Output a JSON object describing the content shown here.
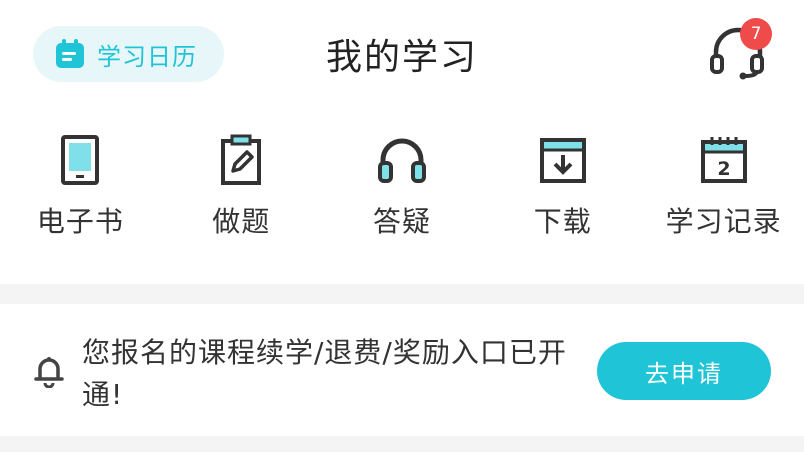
{
  "header": {
    "calendar_label": "学习日历",
    "title": "我的学习",
    "support_badge": "7"
  },
  "nav": {
    "items": [
      {
        "label": "电子书",
        "icon": "ebook-icon"
      },
      {
        "label": "做题",
        "icon": "clipboard-pen-icon"
      },
      {
        "label": "答疑",
        "icon": "headphones-icon"
      },
      {
        "label": "下载",
        "icon": "download-folder-icon"
      },
      {
        "label": "学习记录",
        "icon": "calendar-record-icon"
      }
    ]
  },
  "notice": {
    "text": "您报名的课程续学/退费/奖励入口已开通!",
    "button_label": "去申请"
  },
  "colors": {
    "accent": "#1fc5d6",
    "accent_light": "#e7f7f9",
    "badge": "#ef4b4b",
    "icon_dark": "#333333",
    "icon_fill": "#7fe0ea"
  }
}
